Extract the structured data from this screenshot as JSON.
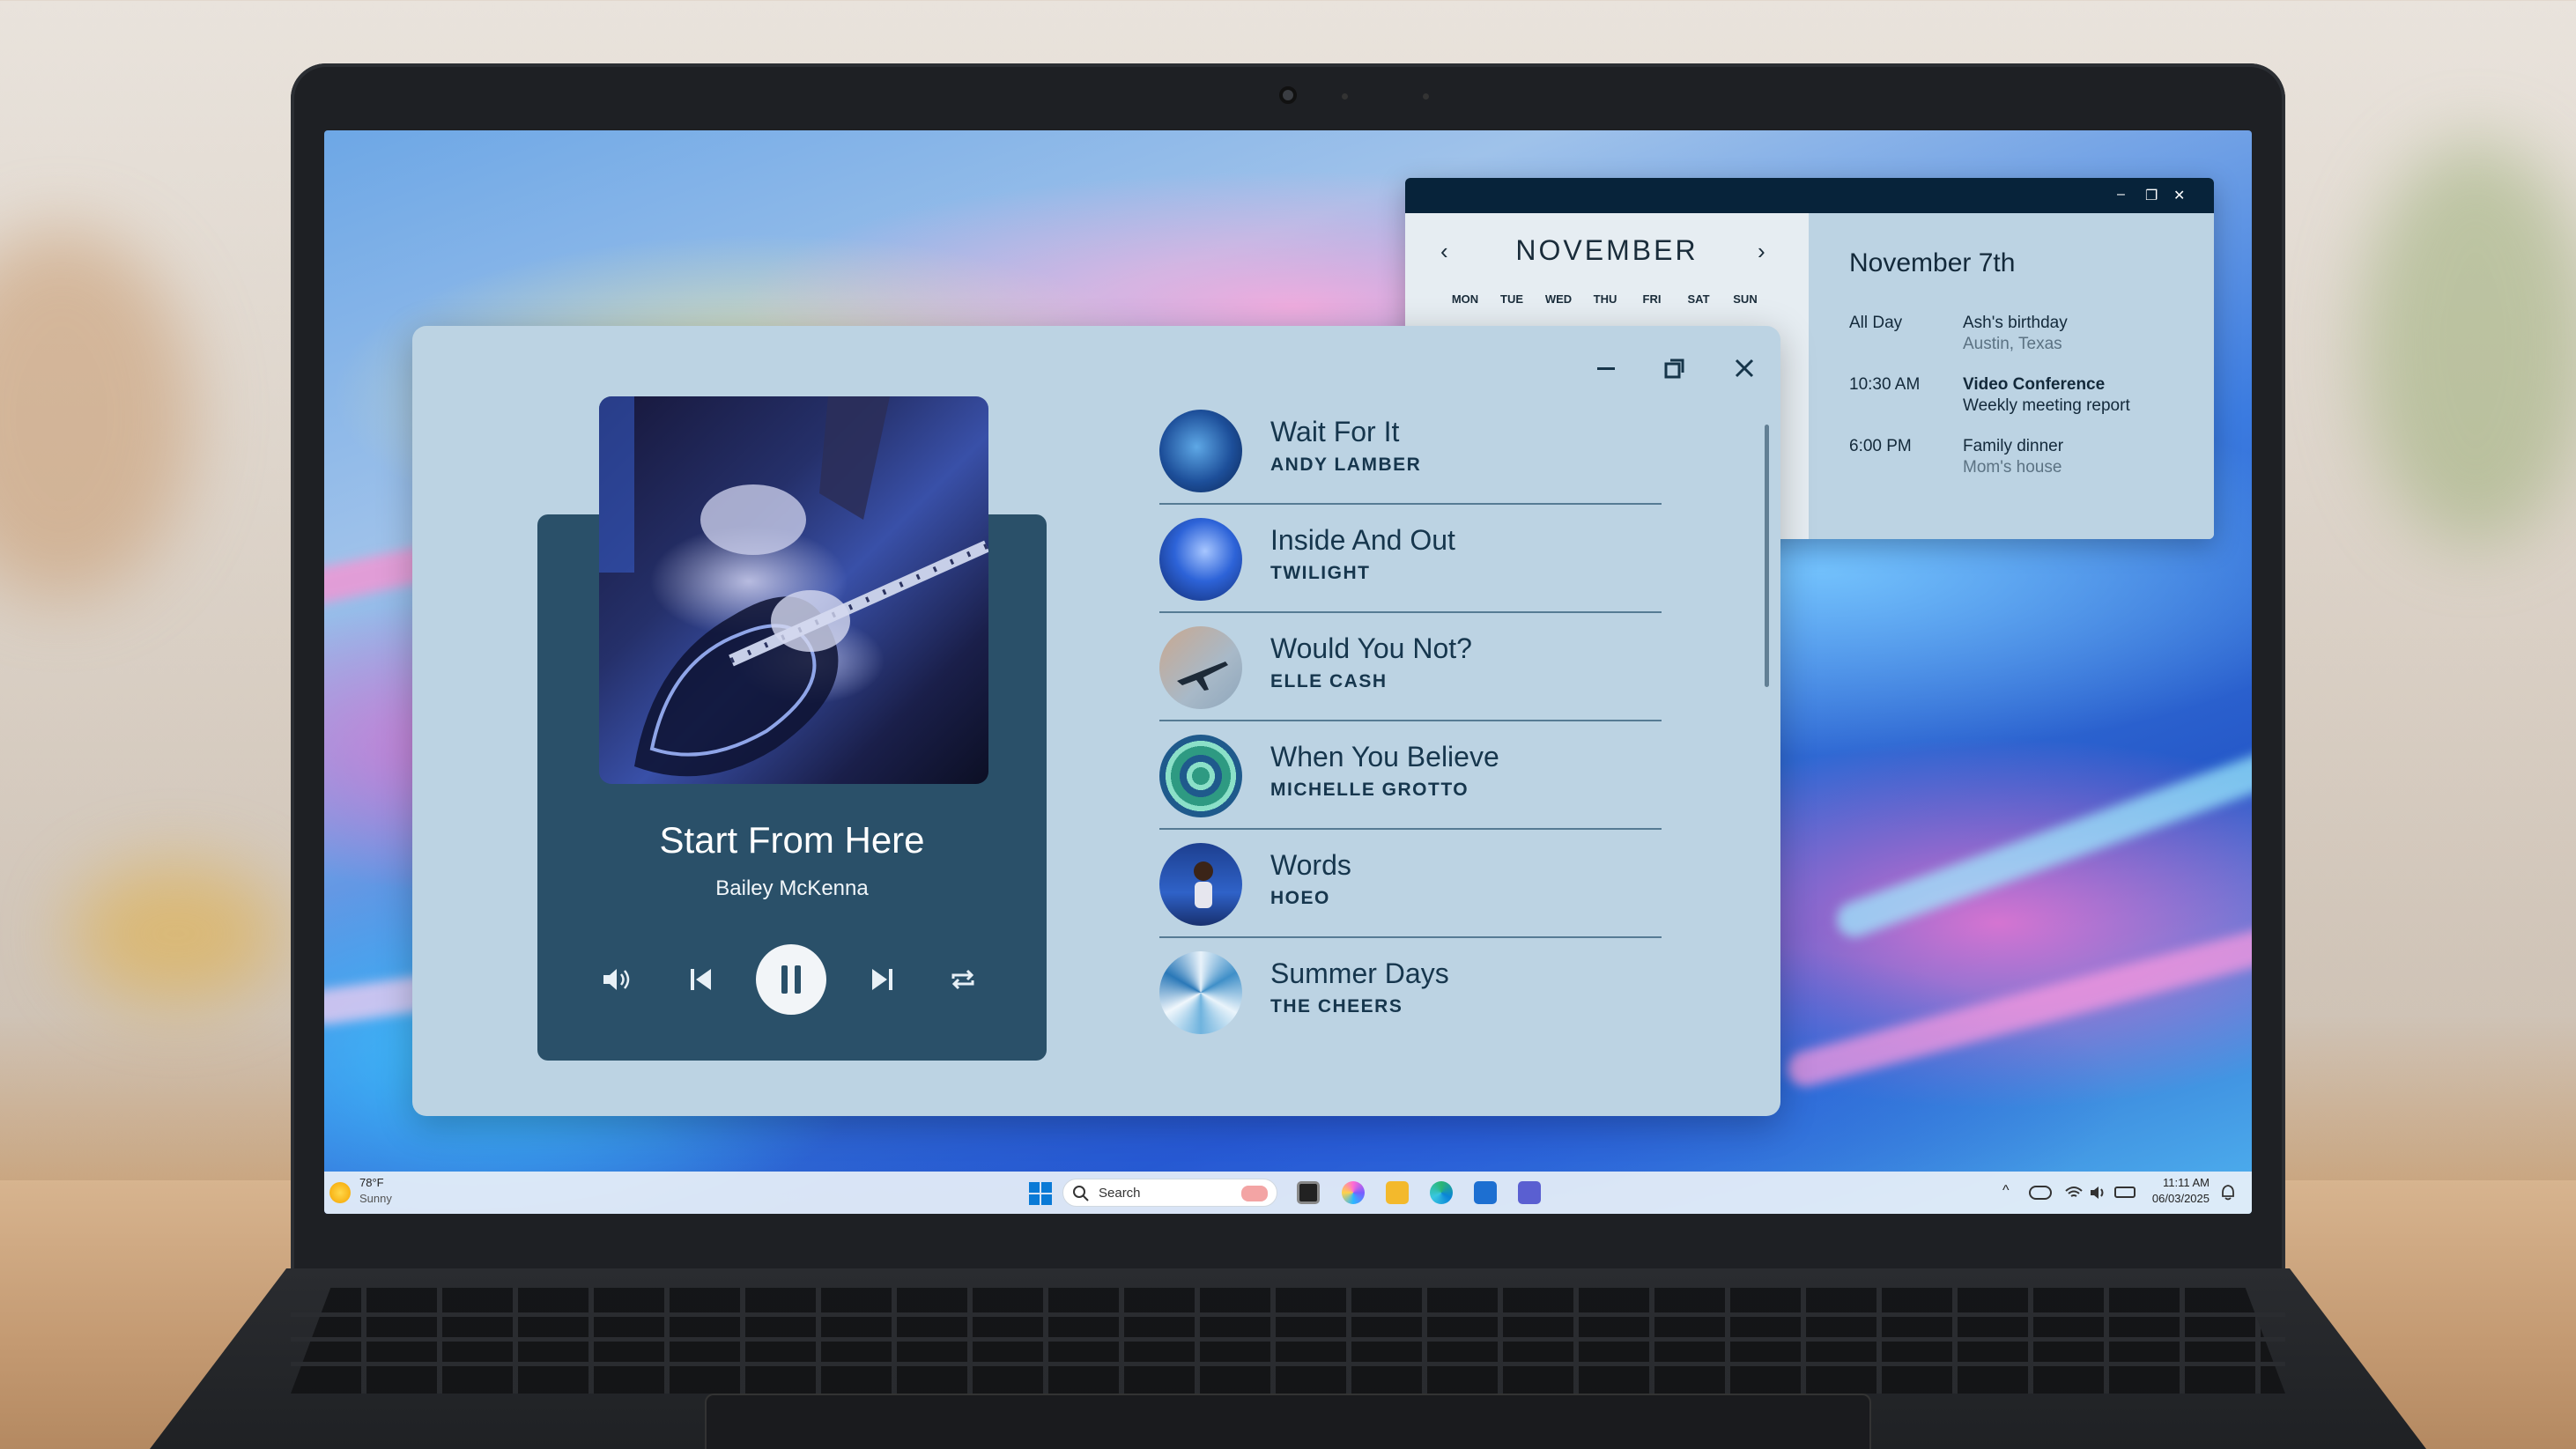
{
  "player": {
    "now_playing": {
      "title": "Start From Here",
      "artist": "Bailey McKenna"
    },
    "window_controls": {
      "minimize": "–",
      "restore": "❐",
      "close": "✕"
    },
    "controls": {
      "volume_icon": "volume-icon",
      "previous_icon": "previous-track-icon",
      "play_pause_icon": "pause-icon",
      "next_icon": "next-track-icon",
      "repeat_icon": "repeat-icon"
    },
    "playlist": [
      {
        "title": "Wait For It",
        "artist": "ANDY LAMBER"
      },
      {
        "title": "Inside And Out",
        "artist": "TWILIGHT"
      },
      {
        "title": "Would You Not?",
        "artist": "ELLE CASH"
      },
      {
        "title": "When You Believe",
        "artist": "MICHELLE GROTTO"
      },
      {
        "title": "Words",
        "artist": "HOEO"
      },
      {
        "title": "Summer Days",
        "artist": "THE CHEERS"
      }
    ],
    "colors": {
      "window_bg": "#bcd3e3",
      "card_bg": "#2a5069",
      "text": "#16364d"
    }
  },
  "calendar": {
    "month": "NOVEMBER",
    "prev": "‹",
    "next": "›",
    "weekdays": [
      "MON",
      "TUE",
      "WED",
      "THU",
      "FRI",
      "SAT",
      "SUN"
    ],
    "selected_date": "November 7th",
    "events": [
      {
        "time": "All Day",
        "title": "Ash's birthday",
        "subtitle": "Austin, Texas"
      },
      {
        "time": "10:30 AM",
        "title": "Video Conference",
        "subtitle": "Weekly meeting report"
      },
      {
        "time": "6:00 PM",
        "title": "Family dinner",
        "subtitle": "Mom's house"
      }
    ],
    "window_controls": {
      "minimize": "–",
      "restore": "❐",
      "close": "✕"
    }
  },
  "taskbar": {
    "weather": {
      "temp": "78°F",
      "condition": "Sunny"
    },
    "search_placeholder": "Search",
    "clock": {
      "time": "11:11 AM",
      "date": "06/03/2025"
    },
    "tray_chevron": "^"
  }
}
